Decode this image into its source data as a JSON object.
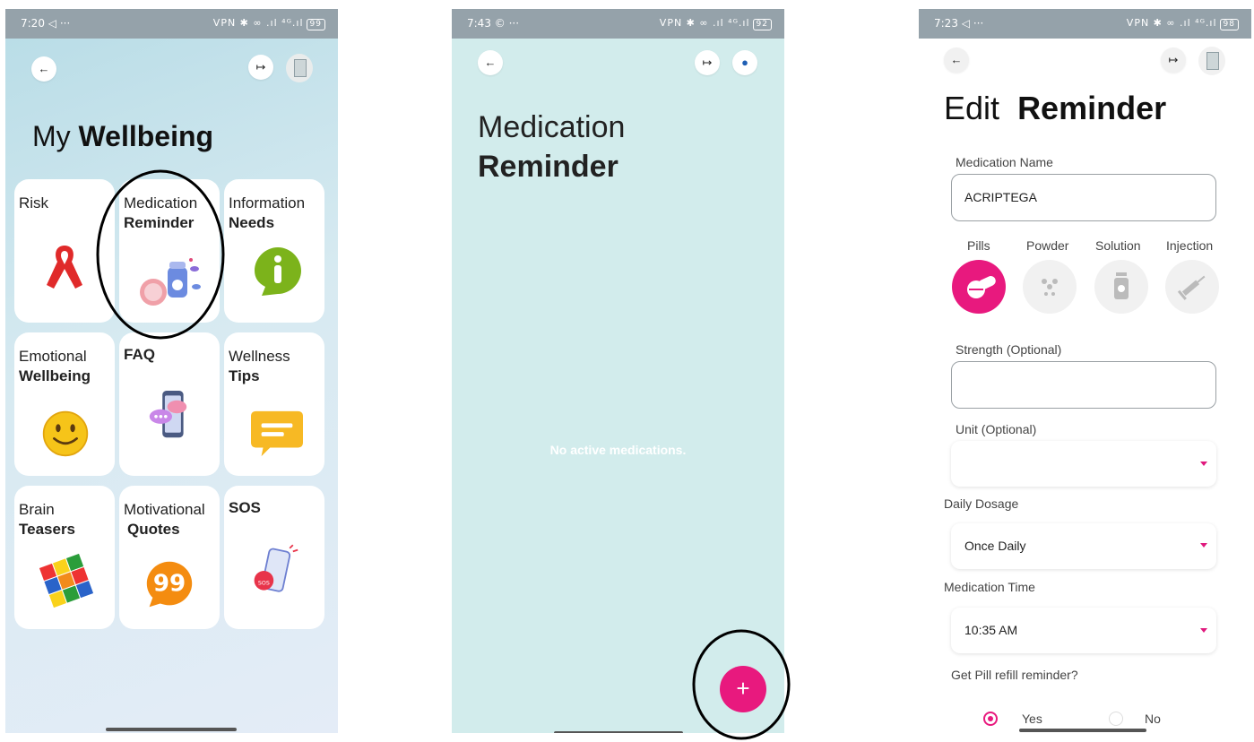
{
  "screen1": {
    "status": {
      "time": "7:20",
      "icons": "◁ ···",
      "right": "VPN ✱ ∞ .ıl ⁴ᴳ.ıl",
      "battery": "99"
    },
    "title_light": "My",
    "title_bold": "Wellbeing",
    "tiles": [
      {
        "line1": "Risk",
        "line2": ""
      },
      {
        "line1": "Medication",
        "line2": "Reminder"
      },
      {
        "line1": "Information",
        "line2": "Needs"
      },
      {
        "line1": "Emotional",
        "line2": "Wellbeing"
      },
      {
        "line1": "",
        "line2": "FAQ"
      },
      {
        "line1": "Wellness",
        "line2": "Tips"
      },
      {
        "line1": "Brain",
        "line2": "Teasers"
      },
      {
        "line1": "Motivational",
        "line2": "Quotes"
      },
      {
        "line1": "",
        "line2": "SOS"
      }
    ]
  },
  "screen2": {
    "status": {
      "time": "7:43",
      "icons": "© ···",
      "right": "VPN ✱ ∞ .ıl ⁴ᴳ.ıl",
      "battery": "92"
    },
    "title_light": "Medication",
    "title_bold": "Reminder",
    "empty_text": "No active medications.",
    "fab_label": "+"
  },
  "screen3": {
    "status": {
      "time": "7:23",
      "icons": "◁ ···",
      "right": "VPN ✱ ∞ .ıl ⁴ᴳ.ıl",
      "battery": "98"
    },
    "title_light": "Edit",
    "title_bold": "Reminder",
    "medication_name_label": "Medication Name",
    "medication_name_value": "ACRIPTEGA",
    "forms": [
      {
        "label": "Pills",
        "selected": true
      },
      {
        "label": "Powder",
        "selected": false
      },
      {
        "label": "Solution",
        "selected": false
      },
      {
        "label": "Injection",
        "selected": false
      }
    ],
    "strength_label": "Strength (Optional)",
    "strength_value": "",
    "unit_label": "Unit (Optional)",
    "unit_value": "",
    "daily_dosage_label": "Daily Dosage",
    "daily_dosage_value": "Once Daily",
    "medication_time_label": "Medication Time",
    "medication_time_value": "10:35 AM",
    "refill_question": "Get Pill refill reminder?",
    "refill_yes": "Yes",
    "refill_no": "No",
    "refill_selected": "Yes"
  },
  "colors": {
    "accent": "#e0197d",
    "screen2_bg": "#d2ecec",
    "statusbar": "#95a2aa"
  },
  "icons": {
    "back": "arrow-left-icon",
    "logout": "logout-icon",
    "profile": "person-icon"
  }
}
